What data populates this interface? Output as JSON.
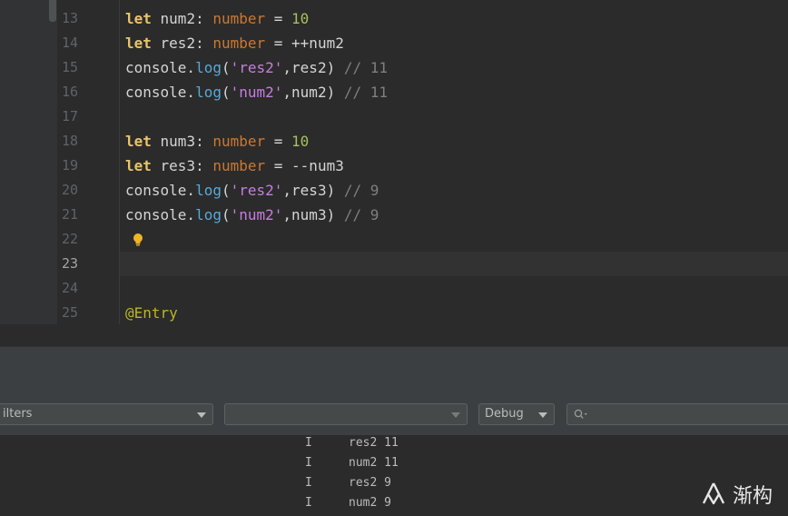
{
  "editor": {
    "lines": [
      {
        "num": "13",
        "tokens": [
          [
            "kw",
            "let"
          ],
          [
            "op",
            " num2: "
          ],
          [
            "ty",
            "number"
          ],
          [
            "op",
            " = "
          ],
          [
            "num",
            "10"
          ]
        ]
      },
      {
        "num": "14",
        "tokens": [
          [
            "kw",
            "let"
          ],
          [
            "op",
            " res2: "
          ],
          [
            "ty",
            "number"
          ],
          [
            "op",
            " = ++num2"
          ]
        ]
      },
      {
        "num": "15",
        "tokens": [
          [
            "op",
            "console."
          ],
          [
            "fn",
            "log"
          ],
          [
            "op",
            "("
          ],
          [
            "str",
            "'res2'"
          ],
          [
            "op",
            ",res2) "
          ],
          [
            "cm",
            "// 11"
          ]
        ]
      },
      {
        "num": "16",
        "tokens": [
          [
            "op",
            "console."
          ],
          [
            "fn",
            "log"
          ],
          [
            "op",
            "("
          ],
          [
            "str",
            "'num2'"
          ],
          [
            "op",
            ",num2) "
          ],
          [
            "cm",
            "// 11"
          ]
        ]
      },
      {
        "num": "17",
        "tokens": []
      },
      {
        "num": "18",
        "tokens": [
          [
            "kw",
            "let"
          ],
          [
            "op",
            " num3: "
          ],
          [
            "ty",
            "number"
          ],
          [
            "op",
            " = "
          ],
          [
            "num",
            "10"
          ]
        ]
      },
      {
        "num": "19",
        "tokens": [
          [
            "kw",
            "let"
          ],
          [
            "op",
            " res3: "
          ],
          [
            "ty",
            "number"
          ],
          [
            "op",
            " = --num3"
          ]
        ]
      },
      {
        "num": "20",
        "tokens": [
          [
            "op",
            "console."
          ],
          [
            "fn",
            "log"
          ],
          [
            "op",
            "("
          ],
          [
            "str",
            "'res2'"
          ],
          [
            "op",
            ",res3) "
          ],
          [
            "cm",
            "// 9"
          ]
        ]
      },
      {
        "num": "21",
        "tokens": [
          [
            "op",
            "console."
          ],
          [
            "fn",
            "log"
          ],
          [
            "op",
            "("
          ],
          [
            "str",
            "'num2'"
          ],
          [
            "op",
            ",num3) "
          ],
          [
            "cm",
            "// 9"
          ]
        ]
      },
      {
        "num": "22",
        "tokens": []
      },
      {
        "num": "23",
        "tokens": [],
        "current": true
      },
      {
        "num": "24",
        "tokens": []
      },
      {
        "num": "25",
        "tokens": [
          [
            "dec",
            "@Entry"
          ]
        ]
      }
    ],
    "bulb_icon": "lightbulb-icon"
  },
  "logcat": {
    "filters_label": "ilters",
    "device_value": "",
    "level_value": "Debug",
    "search_placeholder": "",
    "rows": [
      {
        "level": "I",
        "msg": "res2 11"
      },
      {
        "level": "I",
        "msg": "num2 11"
      },
      {
        "level": "I",
        "msg": "res2 9"
      },
      {
        "level": "I",
        "msg": "num2 9"
      }
    ]
  },
  "watermark": {
    "text": "渐构",
    "icon": "logo-icon"
  },
  "colors": {
    "keyword": "#e8c46a",
    "type": "#cc7832",
    "number": "#a5c25c",
    "function": "#57a8d8",
    "string": "#c77dde",
    "comment": "#7f7f7f",
    "decorator": "#bbb529"
  }
}
